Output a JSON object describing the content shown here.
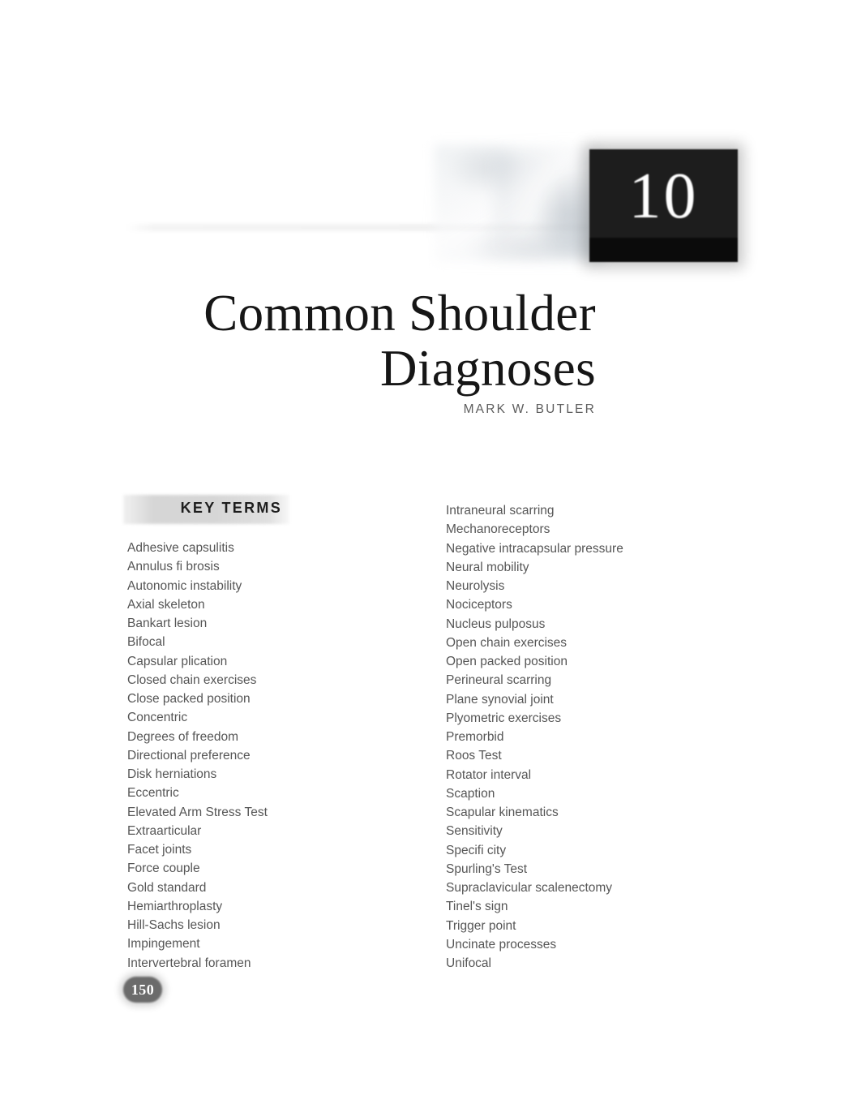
{
  "book_page": {
    "folio": "150"
  },
  "chapter": {
    "number": "10",
    "title_line_1": "Common Shoulder",
    "title_line_2": "Diagnoses",
    "author": "MARK W. BUTLER"
  },
  "key_terms": {
    "heading": "KEY TERMS",
    "left_column": [
      "Adhesive capsulitis",
      "Annulus fi brosis",
      "Autonomic instability",
      "Axial skeleton",
      "Bankart lesion",
      "Bifocal",
      "Capsular plication",
      "Closed chain exercises",
      "Close packed position",
      "Concentric",
      "Degrees of freedom",
      "Directional preference",
      "Disk herniations",
      "Eccentric",
      "Elevated Arm Stress Test",
      "Extraarticular",
      "Facet joints",
      "Force couple",
      "Gold standard",
      "Hemiarthroplasty",
      "Hill-Sachs lesion",
      "Impingement",
      "Intervertebral foramen"
    ],
    "right_column": [
      "Intraneural scarring",
      "Mechanoreceptors",
      "Negative intracapsular pressure",
      "Neural mobility",
      "Neurolysis",
      "Nociceptors",
      "Nucleus pulposus",
      "Open chain exercises",
      "Open packed position",
      "Perineural scarring",
      "Plane synovial joint",
      "Plyometric exercises",
      "Premorbid",
      "Roos Test",
      "Rotator interval",
      "Scaption",
      "Scapular kinematics",
      "Sensitivity",
      "Specifi city",
      "Spurling's Test",
      "Supraclavicular scalenectomy",
      "Tinel's sign",
      "Trigger point",
      "Uncinate processes",
      "Unifocal"
    ]
  },
  "colors": {
    "chapter_tab_background": "#131313",
    "chapter_number_text": "#ffffff",
    "title_text": "#161616",
    "author_text": "#5d5d5d",
    "key_terms_bar": "#d6d6d6",
    "key_terms_heading_text": "#1d1d1d",
    "term_text": "#565656",
    "folio_badge": "#6b6b6b",
    "folio_text": "#ffffff",
    "page_background": "#ffffff"
  }
}
